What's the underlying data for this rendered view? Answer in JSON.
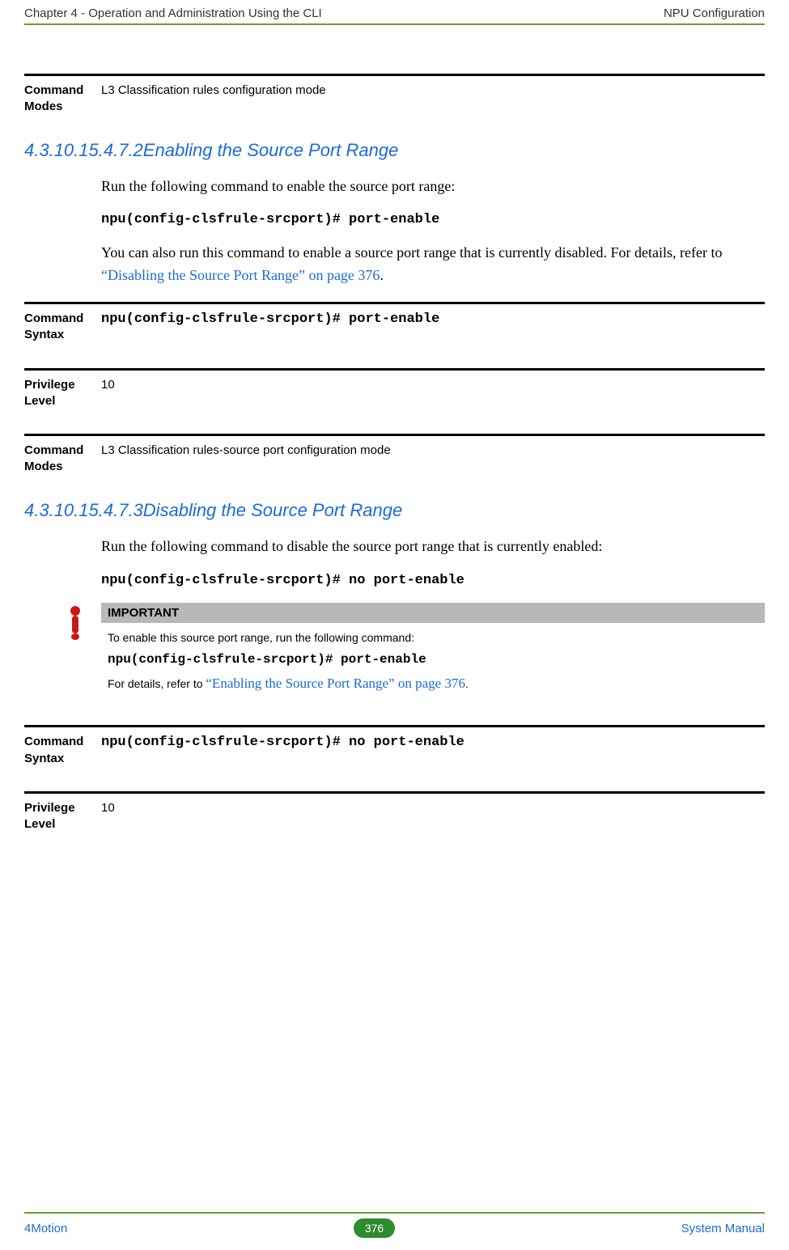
{
  "header": {
    "left": "Chapter 4 - Operation and Administration Using the CLI",
    "right": "NPU Configuration"
  },
  "block1": {
    "label": "Command Modes",
    "value": "L3 Classification rules configuration mode"
  },
  "section1": {
    "number": "4.3.10.15.4.7.2",
    "title": "Enabling the Source Port Range",
    "para1": "Run the following command to enable the source port range:",
    "cmd": "npu(config-clsfrule-srcport)# port-enable",
    "para2_prefix": "You can also run this command to enable a source port range that is currently disabled. For details, refer to ",
    "para2_link": "“Disabling the Source Port Range” on page 376",
    "para2_suffix": "."
  },
  "block2": {
    "label": "Command Syntax",
    "value": "npu(config-clsfrule-srcport)# port-enable"
  },
  "block3": {
    "label": "Privilege Level",
    "value": "10"
  },
  "block4": {
    "label": "Command Modes",
    "value": "L3 Classification rules-source port configuration mode"
  },
  "section2": {
    "number": "4.3.10.15.4.7.3",
    "title": "Disabling the Source Port Range",
    "para1": "Run the following command to disable the source port range that is currently enabled:",
    "cmd": "npu(config-clsfrule-srcport)# no port-enable"
  },
  "important": {
    "header": "IMPORTANT",
    "line1": "To enable this source port range, run the following command:",
    "cmd": "npu(config-clsfrule-srcport)# port-enable",
    "line2_prefix": "For details, refer to ",
    "line2_link": "“Enabling the Source Port Range” on page 376",
    "line2_suffix": "."
  },
  "block5": {
    "label": "Command Syntax",
    "value": "npu(config-clsfrule-srcport)# no port-enable"
  },
  "block6": {
    "label": "Privilege Level",
    "value": "10"
  },
  "footer": {
    "left": "4Motion",
    "page": "376",
    "right": "System Manual"
  }
}
